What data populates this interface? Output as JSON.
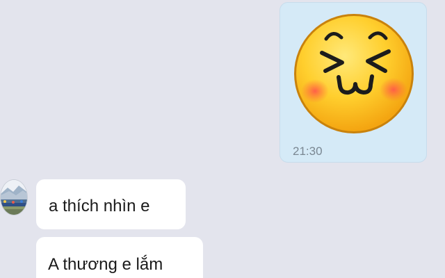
{
  "conversation": {
    "sent_sticker": {
      "sticker_icon": "laughing-emoji-sticker",
      "time": "21:30"
    },
    "received_messages": [
      {
        "text": "a thích nhìn e"
      },
      {
        "text": "A thương e lắm"
      }
    ],
    "colors": {
      "background": "#e3e4ed",
      "sent_bubble": "#d5eaf7",
      "received_bubble": "#ffffff",
      "time_text": "#7a8792"
    }
  }
}
